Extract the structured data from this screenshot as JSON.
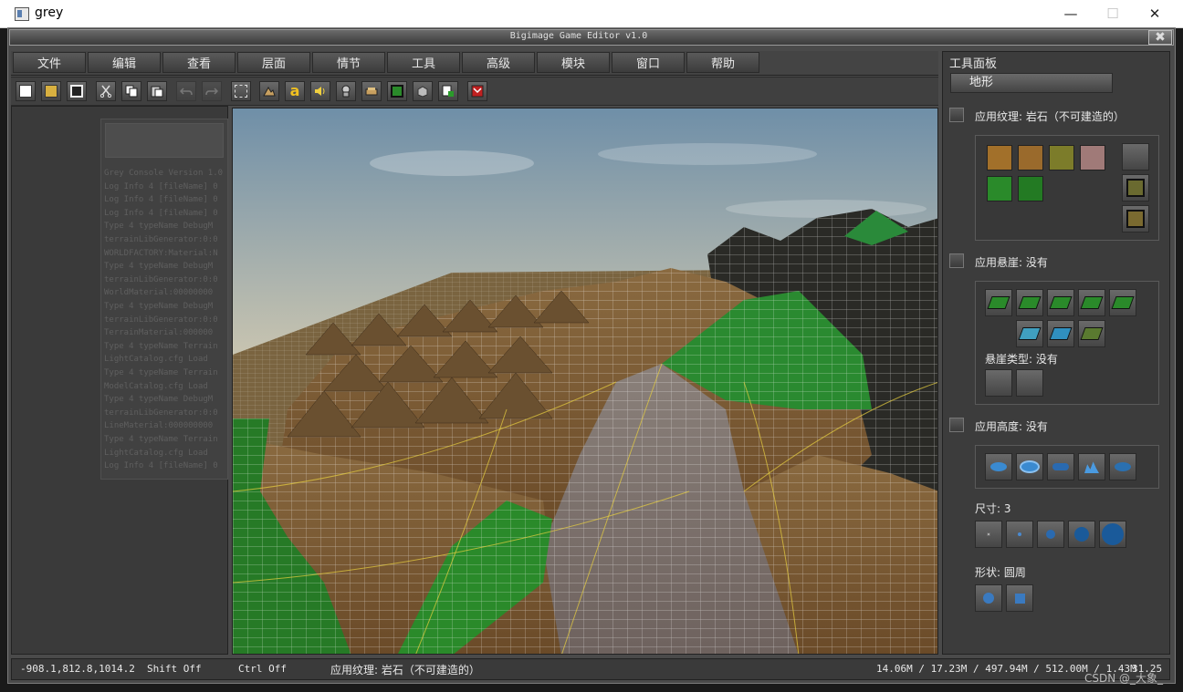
{
  "window": {
    "title": "grey",
    "minimize": "—",
    "maximize": "☐",
    "close": "✕"
  },
  "editor": {
    "title": "Bigimage Game Editor v1.0",
    "close": "✖"
  },
  "menu": [
    "文件",
    "编辑",
    "查看",
    "层面",
    "情节",
    "工具",
    "高级",
    "模块",
    "窗口",
    "帮助"
  ],
  "toolbar": {
    "icons": [
      "new-file-icon",
      "open-folder-icon",
      "save-icon",
      "cut-icon",
      "copy-icon",
      "paste-icon",
      "undo-icon",
      "redo-icon",
      "select-icon",
      "terrain-icon",
      "text-icon",
      "sound-icon",
      "unit-icon",
      "doodad-icon",
      "region-icon",
      "camera-icon",
      "import-icon",
      "test-map-icon"
    ],
    "text_glyph": "a"
  },
  "console": {
    "lines": [
      "Grey Console Version 1.0",
      "Log Info 4  [fileName] 0",
      "Log Info 4  [fileName] 0",
      "Log Info 4  [fileName] 0",
      "Type 4  typeName DebugM",
      "terrainLibGenerator:0:0",
      "WORLDFACTORY:Material:N",
      "Type 4  typeName DebugM",
      "terrainLibGenerator:0:0",
      "WorldMaterial:00000000",
      "Type 4  typeName DebugM",
      "terrainLibGenerator:0:0",
      "TerrainMaterial:000000",
      "Type 4  typeName Terrain",
      "LightCatalog.cfg  Load",
      "Type 4  typeName Terrain",
      "ModelCatalog.cfg  Load",
      "Type 4  typeName DebugM",
      "terrainLibGenerator:0:0",
      "LineMaterial:000000000",
      "Type 4  typeName Terrain",
      "LightCatalog.cfg  Load",
      "Log Info 4  [fileName] 0"
    ]
  },
  "panel": {
    "title": "工具面板",
    "tab": "地形",
    "texture_label": "应用纹理: 岩石（不可建造的）",
    "cliff_label": "应用悬崖: 没有",
    "cliff_type_label": "悬崖类型: 没有",
    "height_label": "应用高度: 没有",
    "size_label": "尺寸: 3",
    "shape_label": "形状: 圆周"
  },
  "colors": {
    "texture_dirt": "#a2702a",
    "texture_dirt2": "#9a6a2c",
    "texture_grass_dirt": "#7c7c2a",
    "texture_rock": "#a07a78",
    "texture_grass": "#2a8a2a",
    "texture_grass2": "#237a23"
  },
  "status": {
    "coords": "-908.1,812.8,1014.2",
    "shift": "Shift Off",
    "ctrl": "Ctrl Off",
    "texture": "应用纹理: 岩石（不可建造的）",
    "memory": "14.06M / 17.23M / 497.94M / 512.00M / 1.43M",
    "fps": "31.25"
  },
  "watermark": "CSDN @_大象_"
}
